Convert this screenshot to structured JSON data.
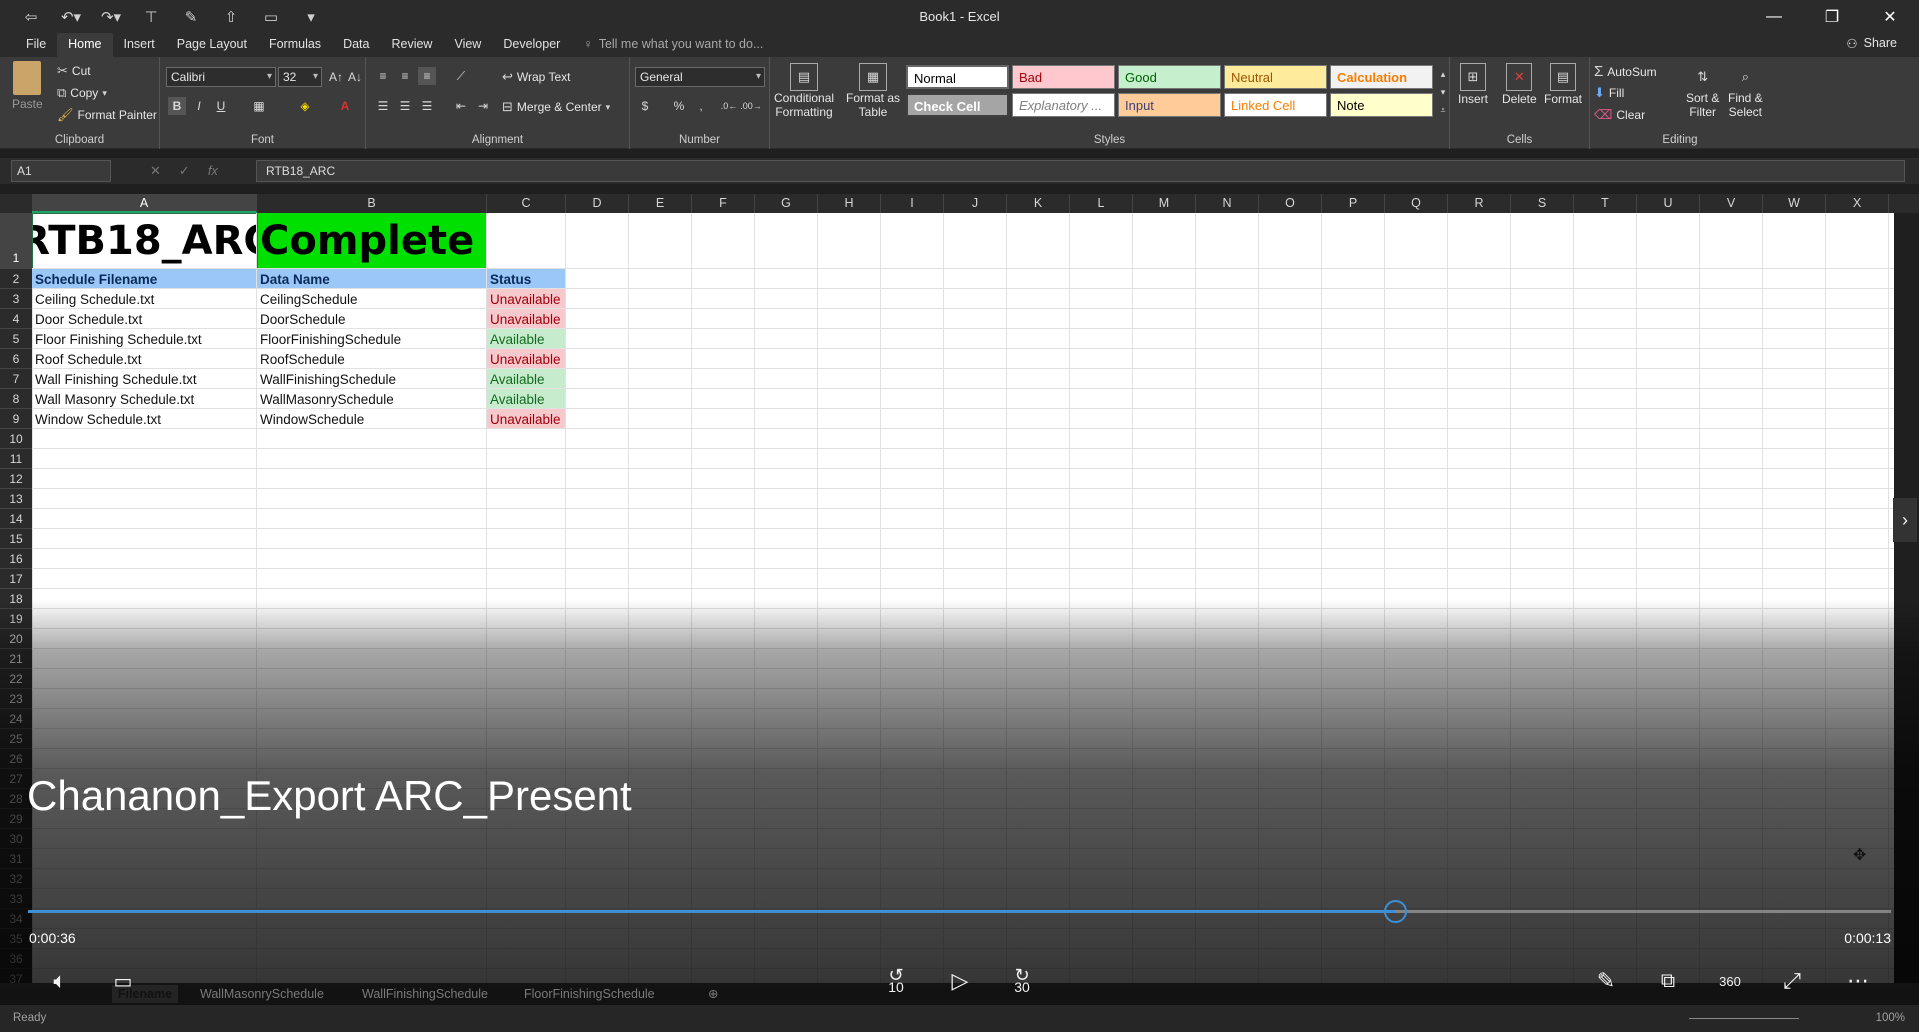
{
  "window": {
    "title": "Book1 - Excel"
  },
  "tabs": [
    "File",
    "Home",
    "Insert",
    "Page Layout",
    "Formulas",
    "Data",
    "Review",
    "View",
    "Developer"
  ],
  "tell_me": "Tell me what you want to do...",
  "share": "Share",
  "ribbon": {
    "clipboard": {
      "paste": "Paste",
      "cut": "Cut",
      "copy": "Copy",
      "format_painter": "Format Painter",
      "label": "Clipboard"
    },
    "font": {
      "name": "Calibri",
      "size": "32",
      "label": "Font",
      "bold": "B",
      "italic": "I",
      "underline": "U"
    },
    "alignment": {
      "wrap": "Wrap Text",
      "merge": "Merge & Center",
      "label": "Alignment"
    },
    "number": {
      "format": "General",
      "label": "Number",
      "currency": "$",
      "percent": "%",
      "comma": ","
    },
    "conditional": {
      "line1": "Conditional",
      "line2": "Formatting"
    },
    "format_table": {
      "line1": "Format as",
      "line2": "Table"
    },
    "styles": {
      "label": "Styles",
      "normal": "Normal",
      "bad": "Bad",
      "good": "Good",
      "neutral": "Neutral",
      "calculation": "Calculation",
      "check_cell": "Check Cell",
      "explanatory": "Explanatory ...",
      "input": "Input",
      "linked": "Linked Cell",
      "note": "Note"
    },
    "cells": {
      "insert": "Insert",
      "delete": "Delete",
      "format": "Format",
      "label": "Cells"
    },
    "editing": {
      "autosum": "AutoSum",
      "fill": "Fill",
      "clear": "Clear",
      "sort_line1": "Sort &",
      "sort_line2": "Filter",
      "find_line1": "Find &",
      "find_line2": "Select",
      "label": "Editing"
    }
  },
  "formula_bar": {
    "name_box": "A1",
    "fx": "fx",
    "formula": "RTB18_ARC"
  },
  "columns": [
    "A",
    "B",
    "C",
    "D",
    "E",
    "F",
    "G",
    "H",
    "I",
    "J",
    "K",
    "L",
    "M",
    "N",
    "O",
    "P",
    "Q",
    "R",
    "S",
    "T",
    "U",
    "V",
    "W",
    "X"
  ],
  "rows": [
    "1",
    "2",
    "3",
    "4",
    "5",
    "6",
    "7",
    "8",
    "9",
    "10",
    "11",
    "12",
    "13",
    "14",
    "15",
    "16",
    "17",
    "18",
    "19",
    "20",
    "21",
    "22",
    "23",
    "24",
    "25",
    "26",
    "27",
    "28",
    "29",
    "30",
    "31",
    "32",
    "33",
    "34",
    "35",
    "36",
    "37"
  ],
  "sheet": {
    "a1": "RTB18_ARC",
    "b1": "Complete !!",
    "headers": [
      "Schedule Filename",
      "Data Name",
      "Status"
    ],
    "records": [
      {
        "file": "Ceiling Schedule.txt",
        "data": "CeilingSchedule",
        "status": "Unavailable"
      },
      {
        "file": "Door Schedule.txt",
        "data": "DoorSchedule",
        "status": "Unavailable"
      },
      {
        "file": "Floor Finishing Schedule.txt",
        "data": "FloorFinishingSchedule",
        "status": "Available"
      },
      {
        "file": "Roof Schedule.txt",
        "data": "RoofSchedule",
        "status": "Unavailable"
      },
      {
        "file": "Wall Finishing Schedule.txt",
        "data": "WallFinishingSchedule",
        "status": "Available"
      },
      {
        "file": "Wall Masonry Schedule.txt",
        "data": "WallMasonrySchedule",
        "status": "Available"
      },
      {
        "file": "Window Schedule.txt",
        "data": "WindowSchedule",
        "status": "Unavailable"
      }
    ]
  },
  "sheet_tabs": [
    "Filename",
    "WallMasonrySchedule",
    "WallFinishingSchedule",
    "FloorFinishingSchedule"
  ],
  "status_bar": {
    "ready": "Ready",
    "zoom": "100%"
  },
  "video": {
    "title": "Chananon_Export ARC_Present",
    "elapsed": "0:00:36",
    "remaining": "0:00:13",
    "progress": 0.7335,
    "skip_back": "10",
    "skip_forward": "30",
    "vr": "360"
  },
  "colors": {
    "complete_green": "#00e000",
    "header_blue": "#9ac7f5",
    "unavailable_bg": "#f6c9cd",
    "available_bg": "#c7eccd",
    "progress_blue": "#3d8fd6"
  }
}
